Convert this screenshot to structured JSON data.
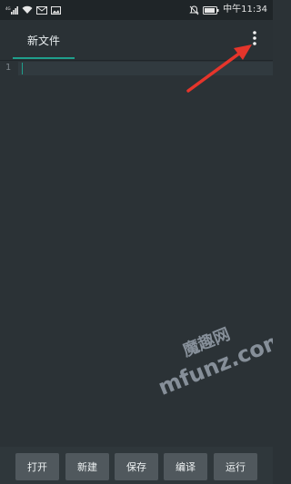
{
  "status_bar": {
    "time": "中午11:34",
    "left_icons": [
      "cellular-signal-icon",
      "wifi-icon",
      "mail-icon",
      "image-icon"
    ],
    "right_icons": [
      "mute-icon",
      "battery-icon"
    ]
  },
  "tabs": [
    {
      "label": "新文件",
      "active": true
    }
  ],
  "toolbar_menu": {
    "icon": "more-vertical-icon"
  },
  "editor": {
    "line_numbers": [
      "1"
    ],
    "content": ""
  },
  "bottom_toolbar": {
    "buttons": [
      {
        "label": "打开"
      },
      {
        "label": "新建"
      },
      {
        "label": "保存"
      },
      {
        "label": "编译"
      },
      {
        "label": "运行"
      }
    ]
  },
  "watermark": {
    "brand_cn": "魔趣网",
    "site": "mfunz.com"
  },
  "colors": {
    "background": "#2b3236",
    "accent": "#1f9f8c",
    "annotation_arrow": "#e5352b",
    "button_bg": "#50585d"
  }
}
